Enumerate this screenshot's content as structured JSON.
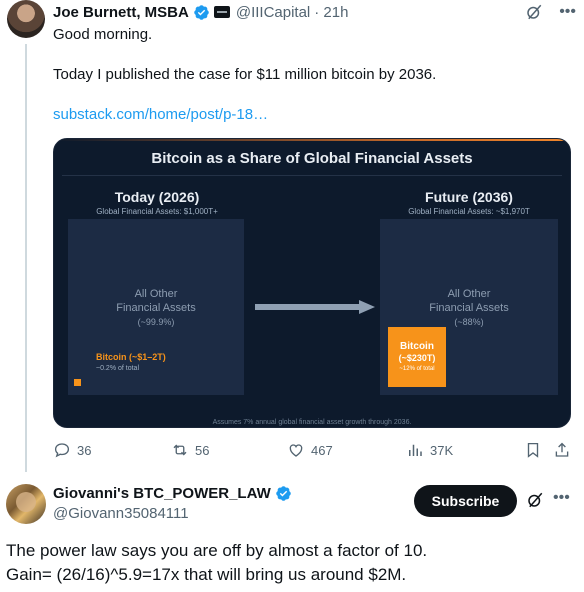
{
  "post": {
    "author_name": "Joe Burnett, MSBA",
    "handle": "@IIICapital",
    "time": "· 21h",
    "line1": "Good morning.",
    "line2": "Today I published the case for $11 million bitcoin by 2036.",
    "link": "substack.com/home/post/p-18…",
    "chart": {
      "title": "Bitcoin as a Share of Global Financial Assets",
      "left_heading": "Today (2026)",
      "left_sub": "Global Financial Assets: $1,000T+",
      "left_panel_l1": "All Other",
      "left_panel_l2": "Financial Assets",
      "left_panel_l3": "(~99.9%)",
      "left_btc_label": "Bitcoin (~$1–2T)",
      "left_btc_sub": "~0.2% of total",
      "right_heading": "Future (2036)",
      "right_sub": "Global Financial Assets: ~$1,970T",
      "right_panel_l1": "All Other",
      "right_panel_l2": "Financial Assets",
      "right_panel_l3": "(~88%)",
      "right_btc_l1": "Bitcoin",
      "right_btc_l2": "(~$230T)",
      "right_btc_l3": "~12% of total",
      "footnote": "Assumes 7% annual global financial asset growth through 2036.",
      "accent": "#f7931a",
      "background": "#0d1a2c"
    },
    "stats": {
      "replies": "36",
      "reposts": "56",
      "likes": "467",
      "views": "37K"
    }
  },
  "reply": {
    "author_name": "Giovanni's BTC_POWER_LAW",
    "handle": "@Giovann35084111",
    "subscribe_label": "Subscribe",
    "line1": "The power law says you are off by almost a factor of 10.",
    "line2": "Gain= (26/16)^5.9=17x that will bring us around $2M."
  },
  "colors": {
    "verified": "#1d9bf0",
    "link": "#1d9bf0",
    "muted": "#536471"
  }
}
